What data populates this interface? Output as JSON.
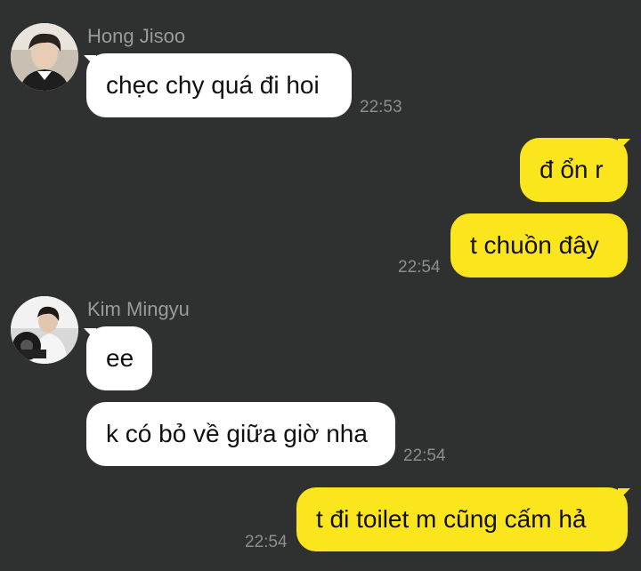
{
  "colors": {
    "background": "#2f3030",
    "incoming_bubble": "#ffffff",
    "outgoing_bubble": "#fbe51d",
    "sender_name": "#9a9a9a",
    "timestamp": "#8d8d8d"
  },
  "messages": [
    {
      "sender": "Hong Jisoo",
      "avatar": "avatar-icon",
      "text": "chẹc chy quá đi hoi",
      "time": "22:53"
    },
    {
      "sender": "me",
      "text": "đ ổn r"
    },
    {
      "sender": "me",
      "text": "t chuồn đây",
      "time": "22:54"
    },
    {
      "sender": "Kim Mingyu",
      "avatar": "avatar-icon",
      "text": "ee"
    },
    {
      "sender": "Kim Mingyu",
      "text": "k có bỏ về giữa giờ nha",
      "time": "22:54"
    },
    {
      "sender": "me",
      "text": "t đi toilet m cũng cấm hả",
      "time": "22:54"
    }
  ]
}
